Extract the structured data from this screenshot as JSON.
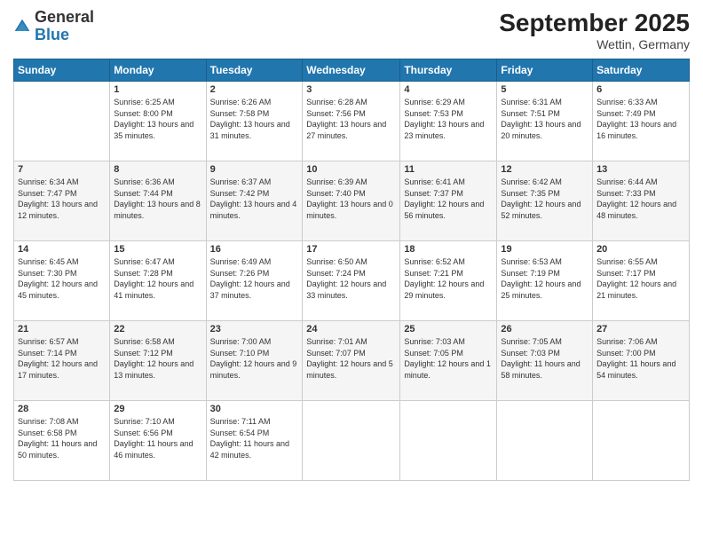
{
  "header": {
    "logo_general": "General",
    "logo_blue": "Blue",
    "month_year": "September 2025",
    "location": "Wettin, Germany"
  },
  "days_of_week": [
    "Sunday",
    "Monday",
    "Tuesday",
    "Wednesday",
    "Thursday",
    "Friday",
    "Saturday"
  ],
  "weeks": [
    [
      {
        "day": "",
        "sunrise": "",
        "sunset": "",
        "daylight": ""
      },
      {
        "day": "1",
        "sunrise": "Sunrise: 6:25 AM",
        "sunset": "Sunset: 8:00 PM",
        "daylight": "Daylight: 13 hours and 35 minutes."
      },
      {
        "day": "2",
        "sunrise": "Sunrise: 6:26 AM",
        "sunset": "Sunset: 7:58 PM",
        "daylight": "Daylight: 13 hours and 31 minutes."
      },
      {
        "day": "3",
        "sunrise": "Sunrise: 6:28 AM",
        "sunset": "Sunset: 7:56 PM",
        "daylight": "Daylight: 13 hours and 27 minutes."
      },
      {
        "day": "4",
        "sunrise": "Sunrise: 6:29 AM",
        "sunset": "Sunset: 7:53 PM",
        "daylight": "Daylight: 13 hours and 23 minutes."
      },
      {
        "day": "5",
        "sunrise": "Sunrise: 6:31 AM",
        "sunset": "Sunset: 7:51 PM",
        "daylight": "Daylight: 13 hours and 20 minutes."
      },
      {
        "day": "6",
        "sunrise": "Sunrise: 6:33 AM",
        "sunset": "Sunset: 7:49 PM",
        "daylight": "Daylight: 13 hours and 16 minutes."
      }
    ],
    [
      {
        "day": "7",
        "sunrise": "Sunrise: 6:34 AM",
        "sunset": "Sunset: 7:47 PM",
        "daylight": "Daylight: 13 hours and 12 minutes."
      },
      {
        "day": "8",
        "sunrise": "Sunrise: 6:36 AM",
        "sunset": "Sunset: 7:44 PM",
        "daylight": "Daylight: 13 hours and 8 minutes."
      },
      {
        "day": "9",
        "sunrise": "Sunrise: 6:37 AM",
        "sunset": "Sunset: 7:42 PM",
        "daylight": "Daylight: 13 hours and 4 minutes."
      },
      {
        "day": "10",
        "sunrise": "Sunrise: 6:39 AM",
        "sunset": "Sunset: 7:40 PM",
        "daylight": "Daylight: 13 hours and 0 minutes."
      },
      {
        "day": "11",
        "sunrise": "Sunrise: 6:41 AM",
        "sunset": "Sunset: 7:37 PM",
        "daylight": "Daylight: 12 hours and 56 minutes."
      },
      {
        "day": "12",
        "sunrise": "Sunrise: 6:42 AM",
        "sunset": "Sunset: 7:35 PM",
        "daylight": "Daylight: 12 hours and 52 minutes."
      },
      {
        "day": "13",
        "sunrise": "Sunrise: 6:44 AM",
        "sunset": "Sunset: 7:33 PM",
        "daylight": "Daylight: 12 hours and 48 minutes."
      }
    ],
    [
      {
        "day": "14",
        "sunrise": "Sunrise: 6:45 AM",
        "sunset": "Sunset: 7:30 PM",
        "daylight": "Daylight: 12 hours and 45 minutes."
      },
      {
        "day": "15",
        "sunrise": "Sunrise: 6:47 AM",
        "sunset": "Sunset: 7:28 PM",
        "daylight": "Daylight: 12 hours and 41 minutes."
      },
      {
        "day": "16",
        "sunrise": "Sunrise: 6:49 AM",
        "sunset": "Sunset: 7:26 PM",
        "daylight": "Daylight: 12 hours and 37 minutes."
      },
      {
        "day": "17",
        "sunrise": "Sunrise: 6:50 AM",
        "sunset": "Sunset: 7:24 PM",
        "daylight": "Daylight: 12 hours and 33 minutes."
      },
      {
        "day": "18",
        "sunrise": "Sunrise: 6:52 AM",
        "sunset": "Sunset: 7:21 PM",
        "daylight": "Daylight: 12 hours and 29 minutes."
      },
      {
        "day": "19",
        "sunrise": "Sunrise: 6:53 AM",
        "sunset": "Sunset: 7:19 PM",
        "daylight": "Daylight: 12 hours and 25 minutes."
      },
      {
        "day": "20",
        "sunrise": "Sunrise: 6:55 AM",
        "sunset": "Sunset: 7:17 PM",
        "daylight": "Daylight: 12 hours and 21 minutes."
      }
    ],
    [
      {
        "day": "21",
        "sunrise": "Sunrise: 6:57 AM",
        "sunset": "Sunset: 7:14 PM",
        "daylight": "Daylight: 12 hours and 17 minutes."
      },
      {
        "day": "22",
        "sunrise": "Sunrise: 6:58 AM",
        "sunset": "Sunset: 7:12 PM",
        "daylight": "Daylight: 12 hours and 13 minutes."
      },
      {
        "day": "23",
        "sunrise": "Sunrise: 7:00 AM",
        "sunset": "Sunset: 7:10 PM",
        "daylight": "Daylight: 12 hours and 9 minutes."
      },
      {
        "day": "24",
        "sunrise": "Sunrise: 7:01 AM",
        "sunset": "Sunset: 7:07 PM",
        "daylight": "Daylight: 12 hours and 5 minutes."
      },
      {
        "day": "25",
        "sunrise": "Sunrise: 7:03 AM",
        "sunset": "Sunset: 7:05 PM",
        "daylight": "Daylight: 12 hours and 1 minute."
      },
      {
        "day": "26",
        "sunrise": "Sunrise: 7:05 AM",
        "sunset": "Sunset: 7:03 PM",
        "daylight": "Daylight: 11 hours and 58 minutes."
      },
      {
        "day": "27",
        "sunrise": "Sunrise: 7:06 AM",
        "sunset": "Sunset: 7:00 PM",
        "daylight": "Daylight: 11 hours and 54 minutes."
      }
    ],
    [
      {
        "day": "28",
        "sunrise": "Sunrise: 7:08 AM",
        "sunset": "Sunset: 6:58 PM",
        "daylight": "Daylight: 11 hours and 50 minutes."
      },
      {
        "day": "29",
        "sunrise": "Sunrise: 7:10 AM",
        "sunset": "Sunset: 6:56 PM",
        "daylight": "Daylight: 11 hours and 46 minutes."
      },
      {
        "day": "30",
        "sunrise": "Sunrise: 7:11 AM",
        "sunset": "Sunset: 6:54 PM",
        "daylight": "Daylight: 11 hours and 42 minutes."
      },
      {
        "day": "",
        "sunrise": "",
        "sunset": "",
        "daylight": ""
      },
      {
        "day": "",
        "sunrise": "",
        "sunset": "",
        "daylight": ""
      },
      {
        "day": "",
        "sunrise": "",
        "sunset": "",
        "daylight": ""
      },
      {
        "day": "",
        "sunrise": "",
        "sunset": "",
        "daylight": ""
      }
    ]
  ]
}
